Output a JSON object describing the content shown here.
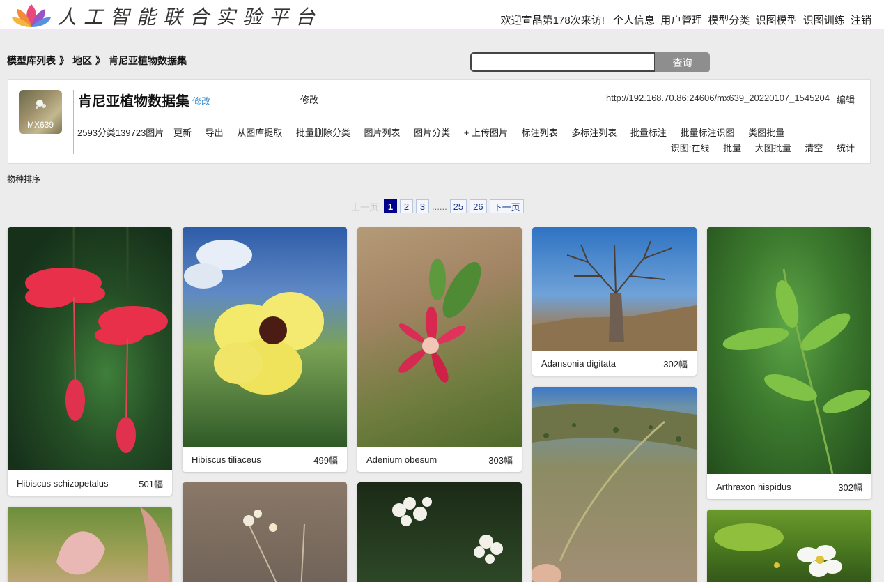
{
  "header": {
    "site_title": "人工智能联合实验平台",
    "welcome": "欢迎宣晶第178次来访!",
    "nav": [
      "个人信息",
      "用户管理",
      "模型分类",
      "识图模型",
      "识图训练",
      "注销"
    ]
  },
  "breadcrumb": {
    "items": [
      "模型库列表",
      "地区",
      "肯尼亚植物数据集"
    ],
    "separator": "》"
  },
  "search": {
    "value": "",
    "placeholder": "",
    "button": "查询"
  },
  "dataset": {
    "thumb_tag": "MX639",
    "title": "肯尼亚植物数据集",
    "edit_link": "修改",
    "edit_link2": "修改",
    "url": "http://192.168.70.86:24606/mx639_20220107_1545204",
    "url_edit": "编辑",
    "stats": "2593分类139723图片",
    "actions": [
      "更新",
      "导出",
      "从图库提取",
      "批量删除分类",
      "图片列表",
      "图片分类",
      "+ 上传图片",
      "标注列表",
      "多标注列表",
      "批量标注",
      "批量标注识图",
      "类图批量"
    ],
    "recog_label": "识图:",
    "recog_actions": [
      "在线",
      "批量",
      "大图批量",
      "清空",
      "统计"
    ]
  },
  "sort_label": "物种排序",
  "pagination": {
    "prev": "上一页",
    "pages": [
      "1",
      "2",
      "3"
    ],
    "dots": "......",
    "last_pages": [
      "25",
      "26"
    ],
    "next": "下一页",
    "current": "1"
  },
  "gallery": [
    {
      "name": "Hibiscus schizopetalus",
      "count": "501幅"
    },
    {
      "name": "Hibiscus tiliaceus",
      "count": "499幅"
    },
    {
      "name": "Adenium obesum",
      "count": "303幅"
    },
    {
      "name": "Adansonia digitata",
      "count": "302幅"
    },
    {
      "name": "Arthraxon hispidus",
      "count": "302幅"
    }
  ],
  "colors": {
    "accent_blue": "#3f8fd0",
    "page_active": "#00008b",
    "search_button": "#8e8e8e",
    "header_strip": "#f1e8f6"
  }
}
